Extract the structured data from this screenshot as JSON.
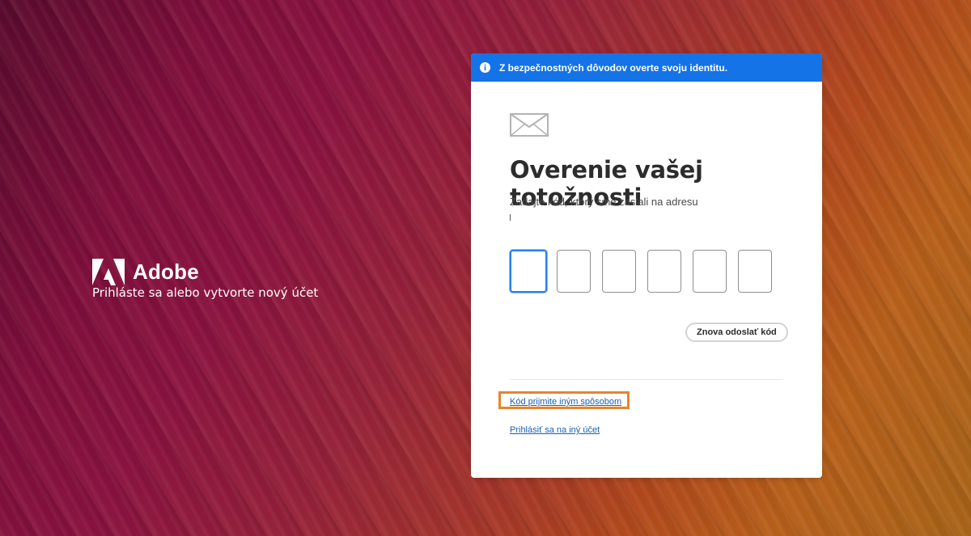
{
  "brand": {
    "name": "Adobe",
    "tagline": "Prihláste sa alebo vytvorte nový účet"
  },
  "banner": {
    "icon": "info-icon",
    "text": "Z bezpečnostných dôvodov overte svoju identitu."
  },
  "verify": {
    "icon": "envelope-icon",
    "title": "Overenie vašej totožnosti",
    "subtitle": "Zadajte kód, ktorý sme zaslali na adresu",
    "code_digits": [
      "",
      "",
      "",
      "",
      "",
      ""
    ],
    "resend_label": "Znova odoslať kód",
    "alt_method_link": "Kód prijmite iným spôsobom",
    "other_account_link": "Prihlásiť sa na iný účet"
  },
  "colors": {
    "banner": "#1473e6",
    "link": "#1b5fb6",
    "highlight": "#e8832c",
    "focus": "#2680eb"
  }
}
